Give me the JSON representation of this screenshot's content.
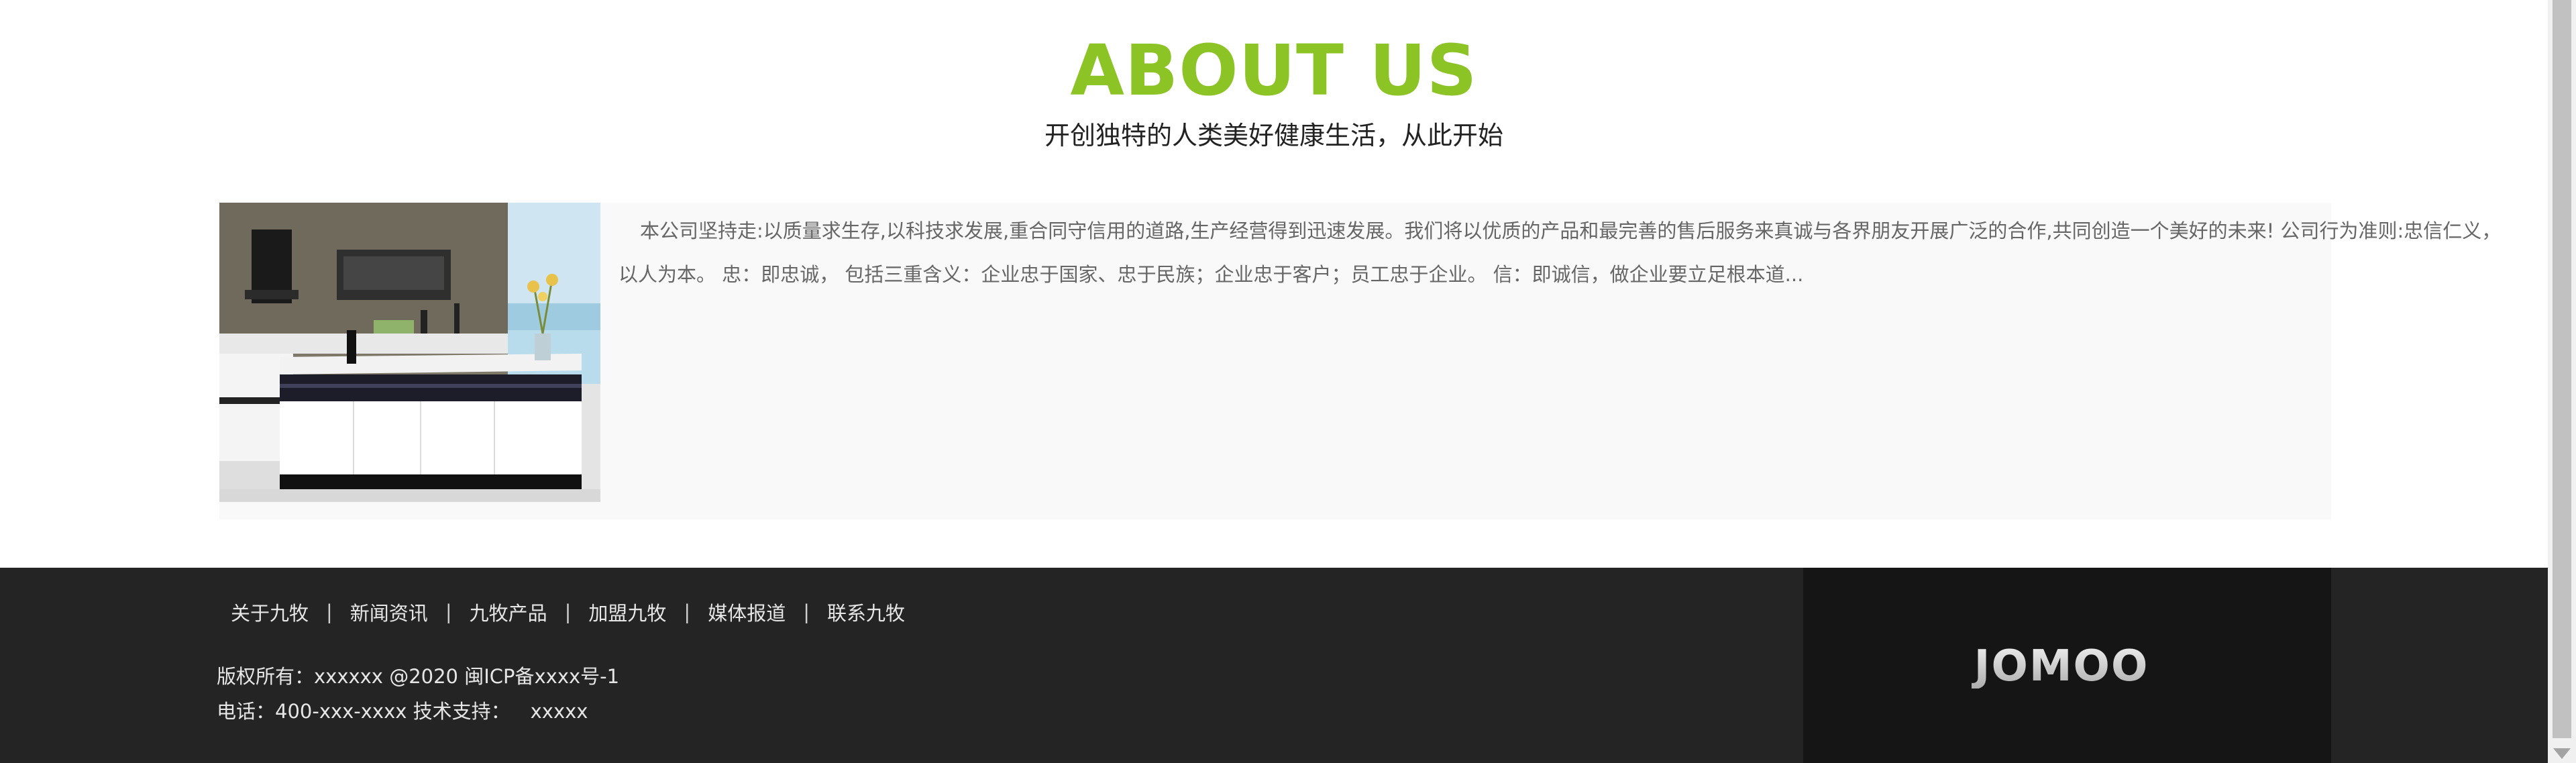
{
  "about": {
    "title": "ABOUT US",
    "subtitle": "开创独特的人类美好健康生活，从此开始",
    "text": "本公司坚持走:以质量求生存,以科技求发展,重合同守信用的道路,生产经营得到迅速发展。我们将以优质的产品和最完善的售后服务来真诚与各界朋友开展广泛的合作,共同创造一个美好的未来! 公司行为准则:忠信仁义，以人为本。 忠：即忠诚， 包括三重含义：企业忠于国家、忠于民族；企业忠于客户；员工忠于企业。 信：即诚信，做企业要立足根本道...",
    "image": "kitchen-photo"
  },
  "footer": {
    "nav": [
      {
        "label": "关于九牧"
      },
      {
        "label": "新闻资讯"
      },
      {
        "label": "九牧产品"
      },
      {
        "label": "加盟九牧"
      },
      {
        "label": "媒体报道"
      },
      {
        "label": "联系九牧"
      }
    ],
    "separator": "|",
    "copyright": "版权所有：xxxxxx @2020 闽ICP备xxxx号-1",
    "phone": "电话：400-xxx-xxxx 技术支持：",
    "support": "xxxxx",
    "logo_text": "JOMOO"
  },
  "colors": {
    "accent": "#8cc425",
    "footer_bg": "#242424",
    "logo_bg": "#151515"
  }
}
